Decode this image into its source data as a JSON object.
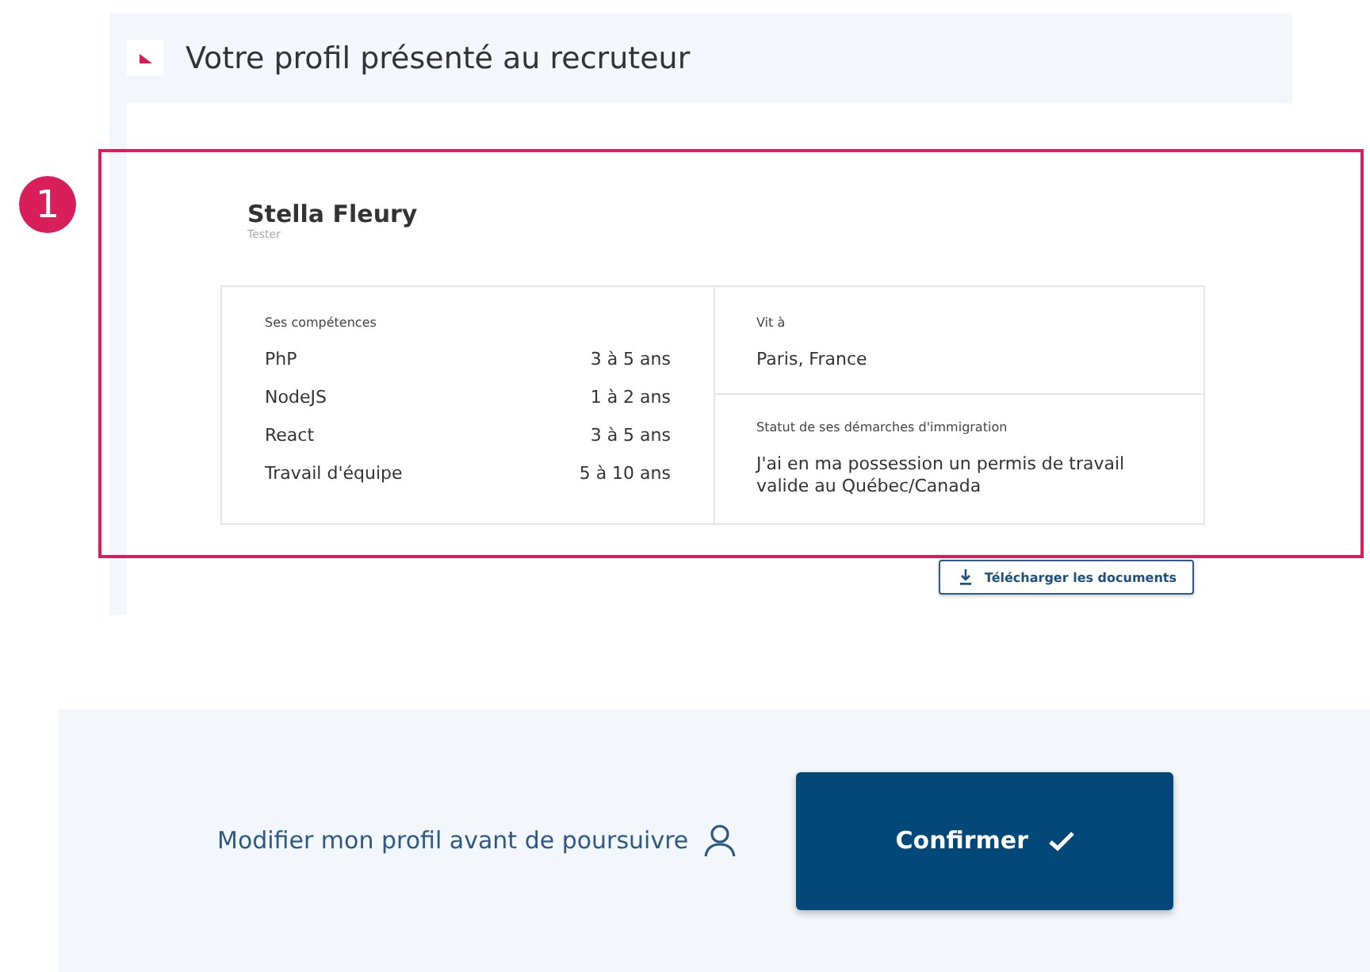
{
  "header": {
    "title": "Votre profil présenté au recruteur"
  },
  "annotation": {
    "badge": "1"
  },
  "profile": {
    "name": "Stella Fleury",
    "role": "Tester"
  },
  "skills": {
    "label": "Ses compétences",
    "items": [
      {
        "name": "PhP",
        "duration": "3 à 5 ans"
      },
      {
        "name": "NodeJS",
        "duration": "1 à 2 ans"
      },
      {
        "name": "React",
        "duration": "3 à 5 ans"
      },
      {
        "name": "Travail d'équipe",
        "duration": "5 à 10 ans"
      }
    ]
  },
  "residence": {
    "label": "Vit à",
    "value": "Paris, France"
  },
  "immigration": {
    "label": "Statut de ses démarches d'immigration",
    "value": "J'ai en ma possession un permis de travail valide au Québec/Canada"
  },
  "download_button": {
    "label": "Télécharger les documents"
  },
  "footer": {
    "edit_link": "Modifier mon profil avant de poursuivre",
    "confirm_button": "Confirmer"
  }
}
